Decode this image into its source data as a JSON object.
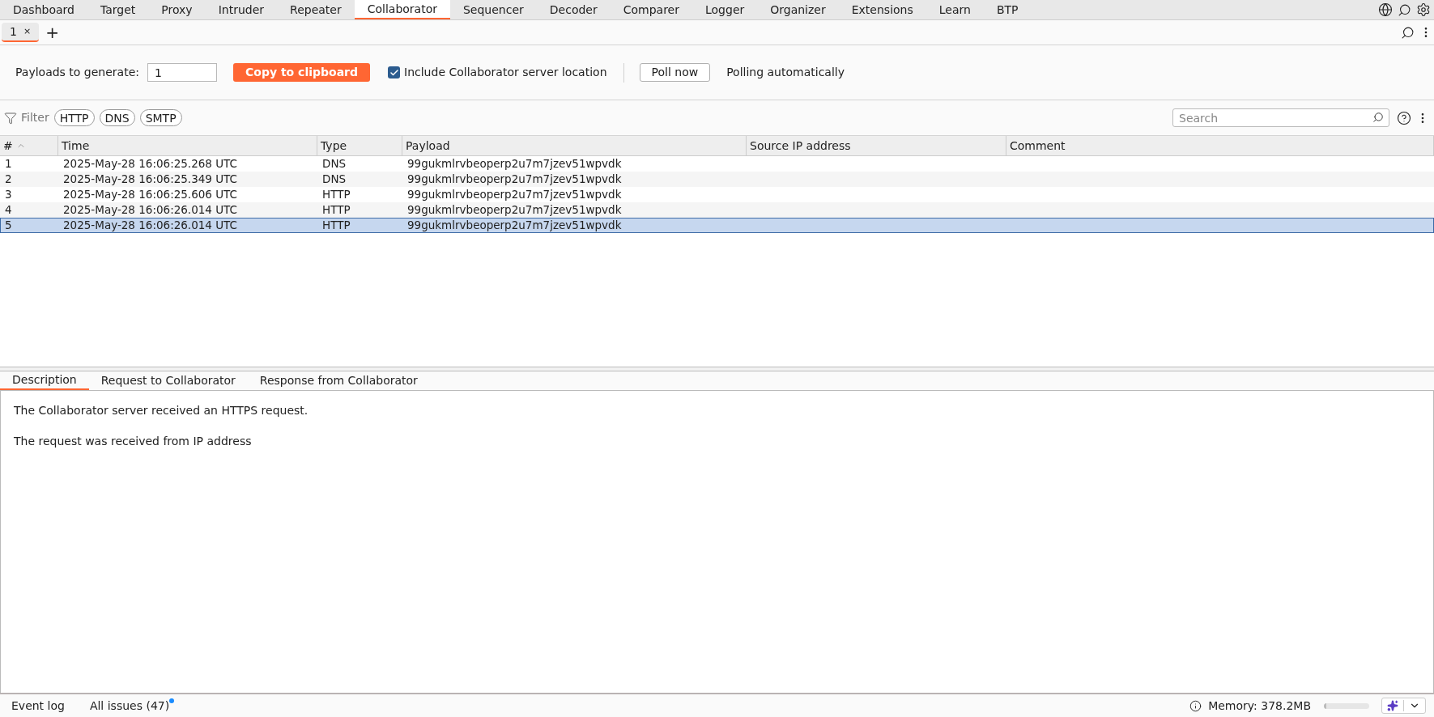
{
  "main_tabs": [
    {
      "label": "Dashboard",
      "selected": false
    },
    {
      "label": "Target",
      "selected": false
    },
    {
      "label": "Proxy",
      "selected": false
    },
    {
      "label": "Intruder",
      "selected": false
    },
    {
      "label": "Repeater",
      "selected": false
    },
    {
      "label": "Collaborator",
      "selected": true
    },
    {
      "label": "Sequencer",
      "selected": false
    },
    {
      "label": "Decoder",
      "selected": false
    },
    {
      "label": "Comparer",
      "selected": false
    },
    {
      "label": "Logger",
      "selected": false
    },
    {
      "label": "Organizer",
      "selected": false
    },
    {
      "label": "Extensions",
      "selected": false
    },
    {
      "label": "Learn",
      "selected": false
    },
    {
      "label": "BTP",
      "selected": false
    }
  ],
  "sub_tabs": [
    {
      "label": "1",
      "close": "×",
      "selected": true
    }
  ],
  "add_tab": "+",
  "toolbar": {
    "payloads_label": "Payloads to generate:",
    "payloads_value": "1",
    "copy_button": "Copy to clipboard",
    "include_location": {
      "label": "Include Collaborator server location",
      "checked": true
    },
    "poll_button": "Poll now",
    "polling_status": "Polling automatically"
  },
  "filter": {
    "label": "Filter",
    "chips": [
      "HTTP",
      "DNS",
      "SMTP"
    ],
    "search_placeholder": "Search"
  },
  "table": {
    "columns": [
      "#",
      "Time",
      "Type",
      "Payload",
      "Source IP address",
      "Comment"
    ],
    "rows": [
      {
        "cells": [
          "1",
          "2025-May-28 16:06:25.268 UTC",
          "DNS",
          "99gukmlrvbeoperp2u7m7jzev51wpvdk"
        ],
        "selected": false
      },
      {
        "cells": [
          "2",
          "2025-May-28 16:06:25.349 UTC",
          "DNS",
          "99gukmlrvbeoperp2u7m7jzev51wpvdk"
        ],
        "selected": false
      },
      {
        "cells": [
          "3",
          "2025-May-28 16:06:25.606 UTC",
          "HTTP",
          "99gukmlrvbeoperp2u7m7jzev51wpvdk"
        ],
        "selected": false
      },
      {
        "cells": [
          "4",
          "2025-May-28 16:06:26.014 UTC",
          "HTTP",
          "99gukmlrvbeoperp2u7m7jzev51wpvdk"
        ],
        "selected": false
      },
      {
        "cells": [
          "5",
          "2025-May-28 16:06:26.014 UTC",
          "HTTP",
          "99gukmlrvbeoperp2u7m7jzev51wpvdk"
        ],
        "selected": true
      }
    ]
  },
  "detail_tabs": [
    {
      "label": "Description",
      "selected": true
    },
    {
      "label": "Request to Collaborator",
      "selected": false
    },
    {
      "label": "Response from Collaborator",
      "selected": false
    }
  ],
  "description": [
    "The Collaborator server received an HTTPS request.",
    "The request was received from IP address"
  ],
  "status_bar": {
    "event_log": "Event log",
    "issues": "All issues (47)",
    "issues_unread": true,
    "memory": "Memory: 378.2MB",
    "memory_bar": {
      "level": 0.05
    }
  }
}
